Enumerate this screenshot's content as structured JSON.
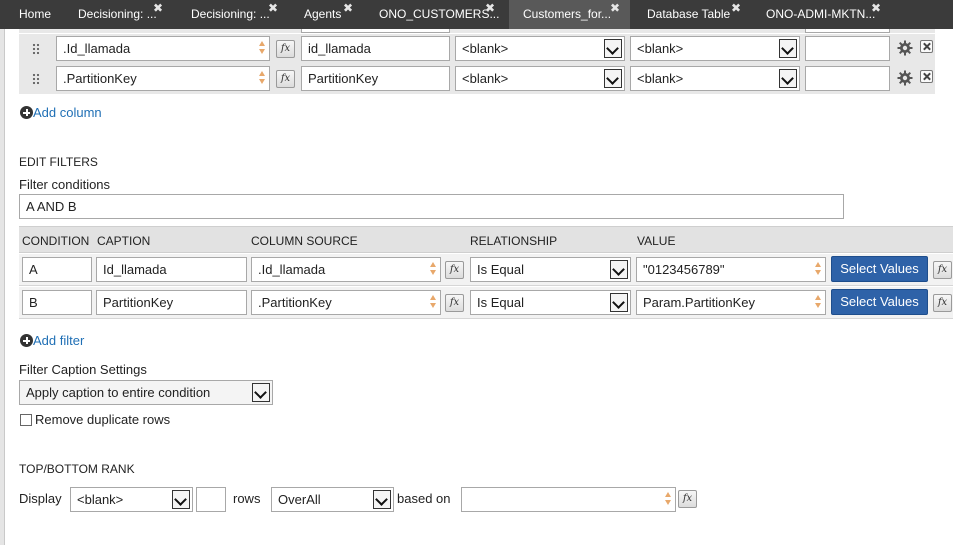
{
  "tabs": [
    {
      "label": "Home",
      "closable": false
    },
    {
      "label": "Decisioning: ...",
      "closable": true
    },
    {
      "label": "Decisioning: ...",
      "closable": true
    },
    {
      "label": "Agents",
      "closable": true
    },
    {
      "label": "ONO_CUSTOMERS...",
      "closable": true
    },
    {
      "label": "Customers_for...",
      "closable": true,
      "active": true
    },
    {
      "label": "Database Table",
      "closable": true
    },
    {
      "label": "ONO-ADMI-MKTN...",
      "closable": true
    }
  ],
  "columns": {
    "rows": [
      {
        "property": ".Id_llamada",
        "label": "id_llamada",
        "select1": "<blank>",
        "select2": "<blank>",
        "width": ""
      },
      {
        "property": ".PartitionKey",
        "label": "PartitionKey",
        "select1": "<blank>",
        "select2": "<blank>",
        "width": ""
      }
    ],
    "add_column": "Add column"
  },
  "fx_label": "fx",
  "edit_filters": {
    "heading": "EDIT FILTERS",
    "conditions_label": "Filter conditions",
    "conditions_value": "A AND B",
    "headers": {
      "condition": "CONDITION",
      "caption": "CAPTION",
      "column_source": "COLUMN SOURCE",
      "relationship": "RELATIONSHIP",
      "value": "VALUE"
    },
    "rows": [
      {
        "condition": "A",
        "caption": "Id_llamada",
        "source": ".Id_llamada",
        "relationship": "Is Equal",
        "value": "\"0123456789\"",
        "button": "Select Values"
      },
      {
        "condition": "B",
        "caption": "PartitionKey",
        "source": ".PartitionKey",
        "relationship": "Is Equal",
        "value": "Param.PartitionKey",
        "button": "Select Values"
      }
    ],
    "add_filter": "Add filter",
    "caption_settings_label": "Filter Caption Settings",
    "caption_settings_value": "Apply caption to entire condition",
    "remove_duplicates_label": "Remove duplicate rows",
    "remove_duplicates_checked": false
  },
  "rank": {
    "heading": "TOP/BOTTOM RANK",
    "display_label": "Display",
    "display_value": "<blank>",
    "count_value": "",
    "rows_label": "rows",
    "scope_value": "OverAll",
    "based_on_label": "based on",
    "based_on_value": ""
  },
  "colors": {
    "accent_button": "#2e62a8",
    "link": "#1f6fb5",
    "tabbar": "#3b3b3b",
    "spinner": "#e8a86b"
  }
}
